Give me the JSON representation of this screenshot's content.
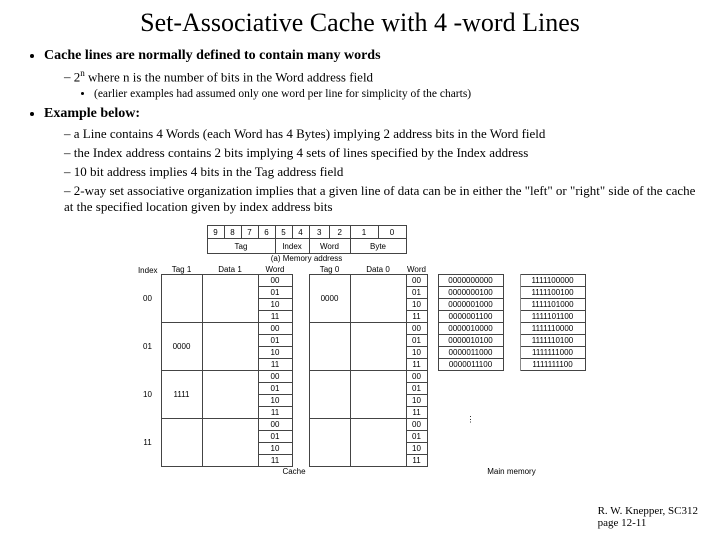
{
  "title": "Set-Associative Cache with 4 -word Lines",
  "bullets": {
    "b1_head": "Cache lines are normally defined to contain many words",
    "b1_s1a": "2",
    "b1_s1b": " where n is the number of bits in the Word address field",
    "b1_s1_dot": "(earlier examples had assumed only one word per line for simplicity of the charts)",
    "b2_head": "Example below:",
    "b2_s1": "a Line contains 4 Words (each Word has 4 Bytes) implying 2 address bits in the Word field",
    "b2_s2": "the Index address contains 2 bits implying 4 sets of lines specified by the Index address",
    "b2_s3": "10 bit address implies 4 bits in the Tag address field",
    "b2_s4": "2-way set associative organization implies that a given line of data can be in either the \"left\" or \"right\" side of the cache at the specified location given by index address bits"
  },
  "diagram": {
    "bitcols": [
      "9",
      "8",
      "7",
      "6",
      "5",
      "4",
      "3",
      "2",
      "1",
      "0"
    ],
    "segments": {
      "tag": "Tag",
      "index": "Index",
      "word": "Word",
      "byte": "Byte"
    },
    "caption_mem_addr": "(a) Memory address",
    "col_headers": {
      "idx": "Index",
      "tag1": "Tag 1",
      "data1": "Data 1",
      "word": "Word",
      "tag0": "Tag 0",
      "data0": "Data 0",
      "word0": "Word"
    },
    "idx": [
      "00",
      "01",
      "10",
      "11"
    ],
    "words": [
      "00",
      "01",
      "10",
      "11"
    ],
    "tag1_r1": "0000",
    "tag1_r2": "1111",
    "tag0_r0": "0000",
    "tag0_r3": "",
    "caption_cache": "Cache",
    "caption_main": "Main memory",
    "mem_top": [
      "0000000000",
      "0000000100",
      "0000001000",
      "0000001100",
      "0000010000",
      "0000010100",
      "0000011000",
      "0000011100"
    ],
    "mem_bot": [
      "1111100000",
      "1111100100",
      "1111101000",
      "1111101100",
      "1111110000",
      "1111110100",
      "1111111000",
      "1111111100"
    ]
  },
  "footer": {
    "l1": "R. W. Knepper, SC312",
    "l2": "page 12-11"
  }
}
